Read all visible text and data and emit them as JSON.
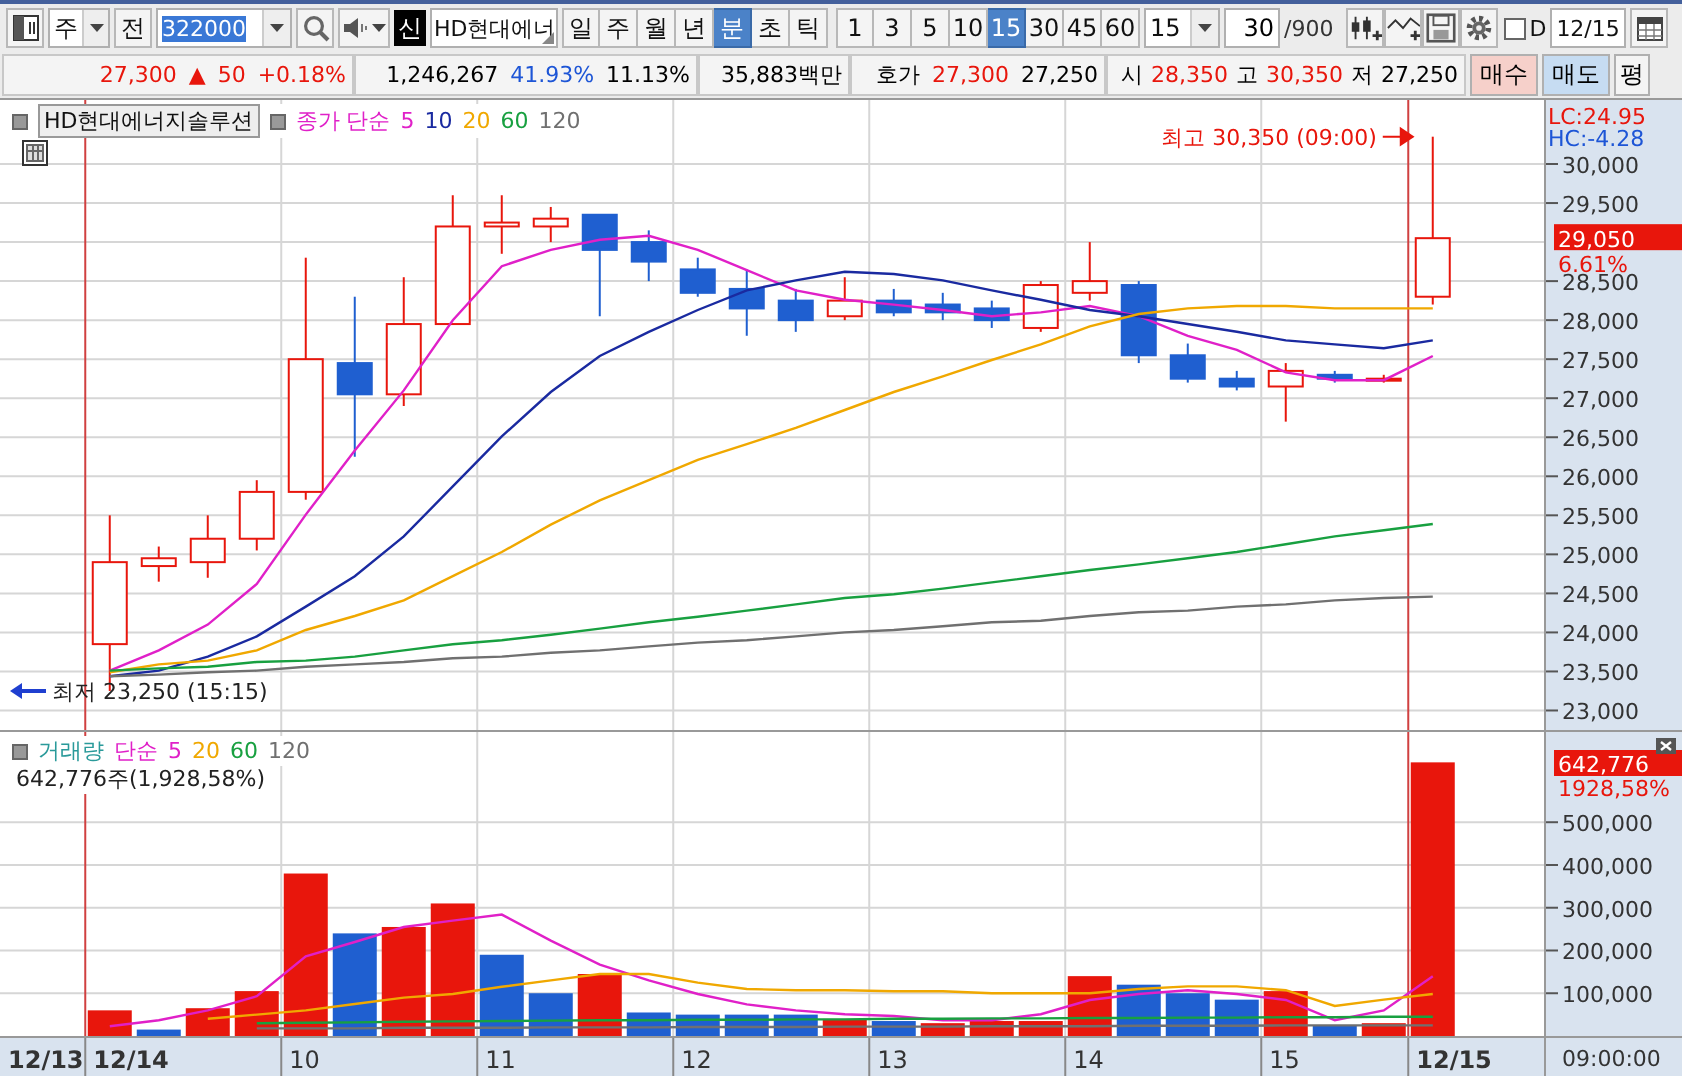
{
  "toolbar": {
    "market": "주",
    "all_button": "전",
    "code": "322000",
    "badge": "신",
    "stock_name": "HD현대에너",
    "periods": [
      {
        "label": "일",
        "selected": false
      },
      {
        "label": "주",
        "selected": false
      },
      {
        "label": "월",
        "selected": false
      },
      {
        "label": "년",
        "selected": false
      },
      {
        "label": "분",
        "selected": true
      },
      {
        "label": "초",
        "selected": false
      },
      {
        "label": "틱",
        "selected": false
      }
    ],
    "intervals": [
      {
        "label": "1",
        "selected": false
      },
      {
        "label": "3",
        "selected": false
      },
      {
        "label": "5",
        "selected": false
      },
      {
        "label": "10",
        "selected": false
      },
      {
        "label": "15",
        "selected": true
      },
      {
        "label": "30",
        "selected": false
      },
      {
        "label": "45",
        "selected": false
      },
      {
        "label": "60",
        "selected": false
      }
    ],
    "interval_select": "15",
    "count": "30",
    "count_max": "/900",
    "d_checkbox": {
      "label": "D",
      "checked": false
    },
    "date": "12/15"
  },
  "quote_bar": {
    "cells": [
      {
        "items": [
          {
            "text": "27,300",
            "color": "#e8160c"
          },
          {
            "text": "▲",
            "color": "#e8160c"
          },
          {
            "text": "50",
            "color": "#e8160c"
          },
          {
            "text": "+0.18%",
            "color": "#e8160c"
          }
        ]
      },
      {
        "items": [
          {
            "text": "1,246,267",
            "color": "#000000"
          },
          {
            "text": "41.93%",
            "color": "#1d55d6"
          },
          {
            "text": "11.13%",
            "color": "#000000"
          }
        ]
      },
      {
        "items": [
          {
            "text": "35,883백만",
            "color": "#000000"
          }
        ]
      },
      {
        "items": [
          {
            "text": "호가",
            "color": "#000000"
          },
          {
            "text": "27,300",
            "color": "#e8160c"
          },
          {
            "text": "27,250",
            "color": "#000000"
          }
        ]
      },
      {
        "items": [
          {
            "text": "시",
            "color": "#000000"
          },
          {
            "text": "28,350",
            "color": "#e8160c"
          },
          {
            "text": "고",
            "color": "#000000"
          },
          {
            "text": "30,350",
            "color": "#e8160c"
          },
          {
            "text": "저",
            "color": "#000000"
          },
          {
            "text": "27,250",
            "color": "#000000"
          }
        ]
      }
    ],
    "buttons": [
      {
        "label": "매수",
        "kind": "buy"
      },
      {
        "label": "매도",
        "kind": "sell"
      },
      {
        "label": "평",
        "kind": "plain"
      }
    ]
  },
  "price_panel": {
    "name_tag": "HD현대에너지솔루션",
    "ma_label": "종가 단순",
    "lc": "LC:24.95",
    "hc": "HC:-4.28",
    "price_tag": "29,050",
    "change_tag": "6.61%",
    "chart_data": {
      "type": "line",
      "grid": true,
      "ylim": [
        22750,
        30820
      ],
      "yticks": [
        {
          "value": 23000,
          "label": "23,000"
        },
        {
          "value": 23500,
          "label": "23,500"
        },
        {
          "value": 24000,
          "label": "24,000"
        },
        {
          "value": 24500,
          "label": "24,500"
        },
        {
          "value": 25000,
          "label": "25,000"
        },
        {
          "value": 25500,
          "label": "25,500"
        },
        {
          "value": 26000,
          "label": "26,000"
        },
        {
          "value": 26500,
          "label": "26,500"
        },
        {
          "value": 27000,
          "label": "27,000"
        },
        {
          "value": 27500,
          "label": "27,500"
        },
        {
          "value": 28000,
          "label": "28,000"
        },
        {
          "value": 28500,
          "label": "28,500"
        },
        {
          "value": 29500,
          "label": "29,500"
        },
        {
          "value": 30000,
          "label": "30,000"
        }
      ],
      "series": [
        {
          "type": "candlestick",
          "ohlc": [
            [
              23850,
              25500,
              23250,
              24900
            ],
            [
              24850,
              25100,
              24650,
              24950
            ],
            [
              24900,
              25500,
              24700,
              25200
            ],
            [
              25200,
              25950,
              25050,
              25800
            ],
            [
              25800,
              28800,
              25700,
              27500
            ],
            [
              27450,
              28300,
              26250,
              27050
            ],
            [
              27050,
              28550,
              26900,
              27950
            ],
            [
              27950,
              29600,
              27950,
              29200
            ],
            [
              29200,
              29600,
              28850,
              29250
            ],
            [
              29200,
              29450,
              29000,
              29300
            ],
            [
              29350,
              29350,
              28050,
              28900
            ],
            [
              29000,
              29150,
              28500,
              28750
            ],
            [
              28650,
              28800,
              28300,
              28350
            ],
            [
              28400,
              28650,
              27800,
              28150
            ],
            [
              28250,
              28400,
              27850,
              28000
            ],
            [
              28050,
              28550,
              28000,
              28250
            ],
            [
              28250,
              28400,
              28050,
              28100
            ],
            [
              28200,
              28350,
              28000,
              28100
            ],
            [
              28150,
              28250,
              27900,
              28000
            ],
            [
              27900,
              28500,
              27850,
              28450
            ],
            [
              28350,
              29000,
              28250,
              28500
            ],
            [
              28450,
              28500,
              27450,
              27550
            ],
            [
              27550,
              27700,
              27200,
              27250
            ],
            [
              27250,
              27350,
              27100,
              27150
            ],
            [
              27150,
              27450,
              26700,
              27350
            ],
            [
              27300,
              27350,
              27200,
              27250
            ],
            [
              27250,
              27300,
              27200,
              27250
            ],
            [
              28300,
              30350,
              28200,
              29050
            ]
          ]
        },
        {
          "name": "5",
          "color": "#e020c8",
          "values": [
            23510,
            23770,
            24100,
            24620,
            25510,
            26330,
            27100,
            28000,
            28690,
            28900,
            29030,
            29080,
            28900,
            28640,
            28380,
            28260,
            28200,
            28130,
            28050,
            28100,
            28180,
            28050,
            27800,
            27620,
            27330,
            27230,
            27230,
            27540
          ]
        },
        {
          "name": "10",
          "color": "#1a2aa0",
          "values": [
            23440,
            23510,
            23690,
            23950,
            24330,
            24720,
            25230,
            25870,
            26510,
            27080,
            27540,
            27850,
            28130,
            28380,
            28510,
            28620,
            28590,
            28510,
            28380,
            28260,
            28130,
            28050,
            27950,
            27850,
            27740,
            27690,
            27640,
            27740
          ]
        },
        {
          "name": "20",
          "color": "#f0a800",
          "values": [
            23490,
            23590,
            23640,
            23770,
            24030,
            24210,
            24410,
            24720,
            25030,
            25380,
            25690,
            25950,
            26210,
            26410,
            26620,
            26850,
            27080,
            27280,
            27490,
            27690,
            27920,
            28080,
            28150,
            28180,
            28180,
            28150,
            28150,
            28150
          ]
        },
        {
          "name": "60",
          "color": "#18a040",
          "values": [
            23510,
            23540,
            23560,
            23620,
            23640,
            23690,
            23770,
            23850,
            23900,
            23970,
            24050,
            24130,
            24200,
            24280,
            24360,
            24440,
            24490,
            24560,
            24640,
            24720,
            24800,
            24870,
            24950,
            25030,
            25130,
            25230,
            25310,
            25390
          ]
        },
        {
          "name": "120",
          "color": "#707070",
          "values": [
            23440,
            23460,
            23490,
            23510,
            23560,
            23590,
            23620,
            23670,
            23690,
            23740,
            23770,
            23820,
            23870,
            23900,
            23950,
            24000,
            24030,
            24080,
            24130,
            24150,
            24210,
            24260,
            24280,
            24330,
            24360,
            24410,
            24440,
            24460
          ]
        }
      ],
      "annotations": [
        "최고 30,350 (09:00)",
        "최저 23,250 (15:15)"
      ]
    }
  },
  "volume_panel": {
    "label": "거래량",
    "ma_label": "단순",
    "summary": "642,776주(1,928,58%)",
    "volume_tag": "642,776",
    "ratio_tag": "1928,58%",
    "time_readout": "09:00:00",
    "time_axis": [
      {
        "label": "12/13",
        "kind": "date"
      },
      {
        "label": "12/14",
        "kind": "date"
      },
      {
        "label": "10",
        "kind": "hour"
      },
      {
        "label": "11",
        "kind": "hour"
      },
      {
        "label": "12",
        "kind": "hour"
      },
      {
        "label": "13",
        "kind": "hour"
      },
      {
        "label": "14",
        "kind": "hour"
      },
      {
        "label": "15",
        "kind": "hour"
      },
      {
        "label": "12/15",
        "kind": "date"
      }
    ],
    "chart_data": {
      "type": "bar",
      "grid": true,
      "ylim": [
        0,
        711000
      ],
      "yticks": [
        {
          "value": 100000,
          "label": "100,000"
        },
        {
          "value": 200000,
          "label": "200,000"
        },
        {
          "value": 300000,
          "label": "300,000"
        },
        {
          "value": 400000,
          "label": "400,000"
        },
        {
          "value": 500000,
          "label": "500,000"
        }
      ],
      "series": [
        {
          "color": "#e8160c",
          "values": [
            60000,
            null,
            65000,
            105000,
            380000,
            null,
            255000,
            310000,
            null,
            null,
            145000,
            null,
            null,
            null,
            null,
            40000,
            null,
            30000,
            35000,
            35000,
            140000,
            null,
            null,
            null,
            105000,
            null,
            30000,
            640000
          ]
        },
        {
          "color": "#1f5fd0",
          "values": [
            null,
            15000,
            null,
            null,
            null,
            240000,
            null,
            null,
            190000,
            100000,
            null,
            55000,
            50000,
            50000,
            50000,
            null,
            35000,
            null,
            null,
            null,
            null,
            120000,
            100000,
            85000,
            null,
            25000,
            null,
            null
          ]
        },
        {
          "type": "line",
          "name": "5",
          "color": "#e020c8",
          "values": [
            23000,
            37000,
            60000,
            93000,
            186000,
            220000,
            255000,
            270000,
            284000,
            223000,
            167000,
            130000,
            98000,
            74000,
            60000,
            51000,
            47000,
            37000,
            37000,
            51000,
            84000,
            98000,
            107000,
            98000,
            84000,
            37000,
            60000,
            140000
          ]
        },
        {
          "type": "line",
          "name": "20",
          "color": "#f0a800",
          "values": [
            null,
            null,
            40000,
            50000,
            60000,
            75000,
            90000,
            98000,
            115000,
            130000,
            145000,
            145000,
            125000,
            110000,
            107000,
            107000,
            105000,
            105000,
            100000,
            100000,
            100000,
            110000,
            116000,
            116000,
            107000,
            70000,
            85000,
            98000
          ]
        },
        {
          "type": "line",
          "name": "60",
          "color": "#18a040",
          "values": [
            null,
            null,
            null,
            30000,
            31000,
            32000,
            33000,
            34000,
            35000,
            36000,
            37000,
            37000,
            38000,
            38000,
            39000,
            39000,
            40000,
            40000,
            41000,
            41000,
            42000,
            42000,
            43000,
            43000,
            44000,
            44000,
            45000,
            45000
          ]
        },
        {
          "type": "line",
          "name": "120",
          "color": "#707070",
          "values": [
            null,
            null,
            null,
            18000,
            18000,
            18000,
            19000,
            19000,
            19000,
            20000,
            20000,
            20000,
            21000,
            21000,
            21000,
            22000,
            22000,
            22000,
            23000,
            23000,
            23000,
            24000,
            24000,
            24000,
            25000,
            25000,
            25000,
            25000
          ]
        }
      ]
    }
  }
}
